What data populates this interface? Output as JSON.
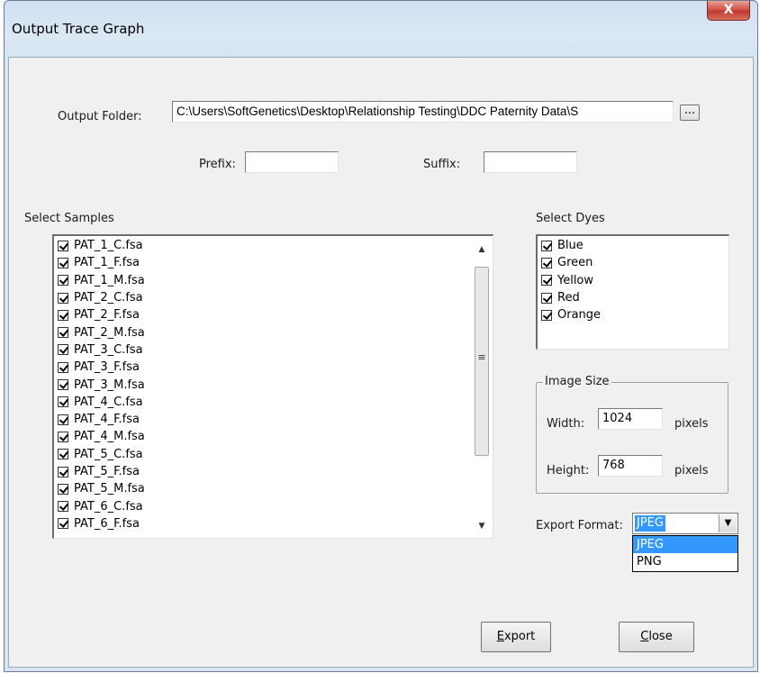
{
  "window": {
    "title": "Output Trace Graph",
    "close_glyph": "X"
  },
  "output_folder": {
    "label": "Output Folder:",
    "value": "C:\\Users\\SoftGenetics\\Desktop\\Relationship Testing\\DDC Paternity Data\\S",
    "browse_label": "..."
  },
  "prefix": {
    "label": "Prefix:",
    "value": ""
  },
  "suffix": {
    "label": "Suffix:",
    "value": ""
  },
  "samples": {
    "label": "Select Samples",
    "items": [
      {
        "name": "PAT_1_C.fsa",
        "checked": true
      },
      {
        "name": "PAT_1_F.fsa",
        "checked": true
      },
      {
        "name": "PAT_1_M.fsa",
        "checked": true
      },
      {
        "name": "PAT_2_C.fsa",
        "checked": true
      },
      {
        "name": "PAT_2_F.fsa",
        "checked": true
      },
      {
        "name": "PAT_2_M.fsa",
        "checked": true
      },
      {
        "name": "PAT_3_C.fsa",
        "checked": true
      },
      {
        "name": "PAT_3_F.fsa",
        "checked": true
      },
      {
        "name": "PAT_3_M.fsa",
        "checked": true
      },
      {
        "name": "PAT_4_C.fsa",
        "checked": true
      },
      {
        "name": "PAT_4_F.fsa",
        "checked": true
      },
      {
        "name": "PAT_4_M.fsa",
        "checked": true
      },
      {
        "name": "PAT_5_C.fsa",
        "checked": true
      },
      {
        "name": "PAT_5_F.fsa",
        "checked": true
      },
      {
        "name": "PAT_5_M.fsa",
        "checked": true
      },
      {
        "name": "PAT_6_C.fsa",
        "checked": true
      },
      {
        "name": "PAT_6_F.fsa",
        "checked": true
      }
    ]
  },
  "dyes": {
    "label": "Select Dyes",
    "items": [
      {
        "name": "Blue",
        "checked": true
      },
      {
        "name": "Green",
        "checked": true
      },
      {
        "name": "Yellow",
        "checked": true
      },
      {
        "name": "Red",
        "checked": true
      },
      {
        "name": "Orange",
        "checked": true
      }
    ]
  },
  "image_size": {
    "label": "Image Size",
    "width_label": "Width:",
    "width_value": "1024",
    "height_label": "Height:",
    "height_value": "768",
    "unit": "pixels"
  },
  "export_format": {
    "label": "Export Format:",
    "selected": "JPEG",
    "options": [
      "JPEG",
      "PNG"
    ]
  },
  "buttons": {
    "export_accel": "E",
    "export_rest": "xport",
    "close_accel": "C",
    "close_rest": "lose"
  },
  "colors": {
    "selection": "#3399ff",
    "close_button": "#c8463b"
  }
}
